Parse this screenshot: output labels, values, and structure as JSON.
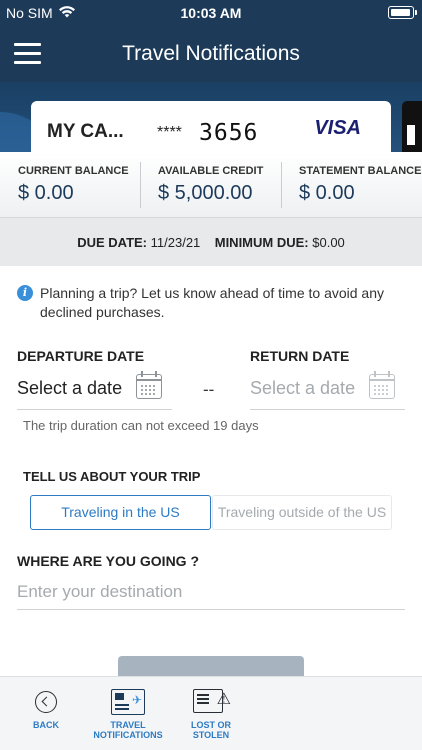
{
  "status_bar": {
    "carrier": "No SIM",
    "time": "10:03 AM"
  },
  "header": {
    "title": "Travel Notifications",
    "menu_icon": "hamburger-menu-icon"
  },
  "card": {
    "name": "MY CA...",
    "masked": "****",
    "last4": "3656",
    "network": "VISA"
  },
  "balances": {
    "current": {
      "label": "CURRENT BALANCE",
      "value": "$ 0.00"
    },
    "available": {
      "label": "AVAILABLE CREDIT",
      "value": "$ 5,000.00"
    },
    "statement": {
      "label": "STATEMENT BALANCE",
      "value": "$ 0.00"
    }
  },
  "due": {
    "due_label": "DUE DATE:",
    "due_value": "11/23/21",
    "min_label": "MINIMUM DUE:",
    "min_value": "$0.00"
  },
  "form": {
    "info_icon": "info-icon",
    "info_text": "Planning a trip? Let us know ahead of time to avoid any declined purchases.",
    "departure": {
      "label": "DEPARTURE DATE",
      "value": "Select a date"
    },
    "separator": "--",
    "return": {
      "label": "RETURN DATE",
      "value": "Select a date"
    },
    "calendar_icon": "calendar-icon",
    "hint": "The trip duration can not exceed 19 days",
    "trip_label": "TELL US ABOUT YOUR TRIP",
    "options": [
      "Traveling in the US",
      "Traveling outside of the US"
    ],
    "selected_option": "Traveling in the US",
    "destination": {
      "label": "WHERE ARE YOU GOING ?",
      "placeholder": "Enter your destination"
    }
  },
  "tabbar": {
    "back": {
      "label": "BACK",
      "icon": "back-circle-icon"
    },
    "travel": {
      "label_line1": "TRAVEL",
      "label_line2": "NOTIFICATIONS",
      "icon": "travel-card-icon"
    },
    "lost": {
      "label_line1": "LOST OR",
      "label_line2": "STOLEN",
      "icon": "lost-card-warning-icon"
    }
  },
  "colors": {
    "header_bg": "#1d3b58",
    "accent": "#2d7bc4",
    "balance_value": "#1c3a5a",
    "submit_disabled": "#a7b4c0"
  }
}
